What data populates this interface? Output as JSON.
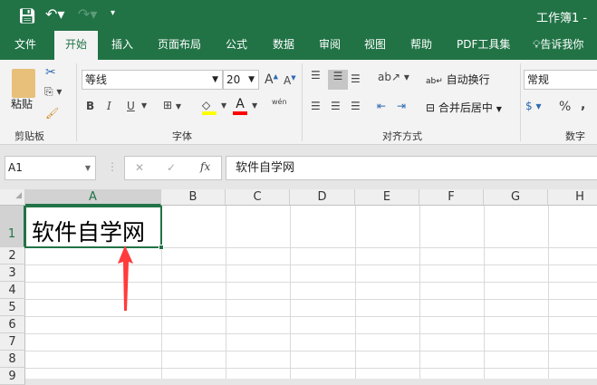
{
  "title": {
    "text": "工作簿1 - "
  },
  "tabs": [
    "文件",
    "开始",
    "插入",
    "页面布局",
    "公式",
    "数据",
    "审阅",
    "视图",
    "帮助",
    "PDF工具集",
    "告诉我你"
  ],
  "ribbon": {
    "clipboard": {
      "paste": "粘贴",
      "label": "剪贴板"
    },
    "font": {
      "name": "等线",
      "size": "20",
      "label": "字体",
      "bold": "B",
      "italic": "I",
      "underline": "U",
      "color": "A",
      "phonetic": "wén",
      "colors": {
        "highlight": "#ffff00",
        "font": "#ff0000"
      }
    },
    "alignment": {
      "wrap": "自动换行",
      "merge": "合并后居中",
      "label": "对齐方式"
    },
    "number": {
      "format": "常规",
      "label": "数字",
      "percent": "%",
      "comma": ","
    }
  },
  "formula_bar": {
    "name_box": "A1",
    "fx": "fx",
    "cancel": "✕",
    "enter": "✓",
    "content": "软件自学网"
  },
  "columns": [
    "A",
    "B",
    "C",
    "D",
    "E",
    "F",
    "G",
    "H"
  ],
  "rows": [
    "1",
    "2",
    "3",
    "4",
    "5",
    "6",
    "7",
    "8",
    "9"
  ],
  "cells": {
    "A1": "软件自学网"
  },
  "accent": "#217346"
}
